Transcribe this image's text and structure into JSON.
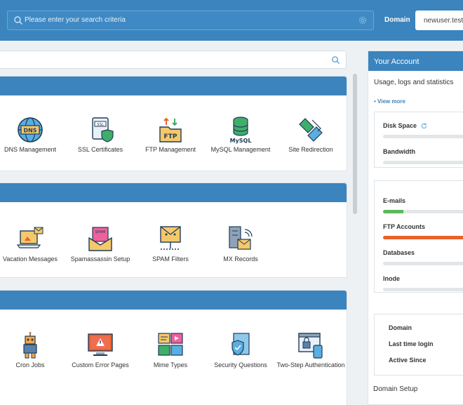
{
  "header": {
    "search_placeholder": "Please enter your search criteria",
    "domain_label": "Domain",
    "domain_value": "newuser.test"
  },
  "sections": [
    {
      "tiles": [
        {
          "label": "DNS Management",
          "icon": "dns-globe-icon"
        },
        {
          "label": "SSL Certificates",
          "icon": "ssl-certificate-icon"
        },
        {
          "label": "FTP Management",
          "icon": "ftp-folder-icon"
        },
        {
          "label": "MySQL Management",
          "icon": "mysql-database-icon"
        },
        {
          "label": "Site Redirection",
          "icon": "redirect-arrows-icon"
        }
      ]
    },
    {
      "tiles": [
        {
          "label": "Vacation Messages",
          "icon": "vacation-laptop-icon"
        },
        {
          "label": "Spamassassin Setup",
          "icon": "spam-envelope-icon"
        },
        {
          "label": "SPAM Filters",
          "icon": "spam-filter-icon"
        },
        {
          "label": "MX Records",
          "icon": "mx-server-icon"
        }
      ]
    },
    {
      "tiles": [
        {
          "label": "Cron Jobs",
          "icon": "robot-icon"
        },
        {
          "label": "Custom Error Pages",
          "icon": "error-monitor-icon"
        },
        {
          "label": "Mime Types",
          "icon": "media-types-icon"
        },
        {
          "label": "Security Questions",
          "icon": "shield-document-icon"
        },
        {
          "label": "Two-Step Authentication",
          "icon": "lock-browser-icon"
        }
      ]
    }
  ],
  "account": {
    "title": "Your Account",
    "subtitle": "Usage, logs and statistics",
    "view_more": "• View more",
    "usage": [
      {
        "label": "Disk Space",
        "fraction": 0
      },
      {
        "label": "Bandwidth",
        "fraction": 0
      }
    ],
    "limits": [
      {
        "label": "E-mails",
        "fraction": 0.22,
        "color": "#5cb85c"
      },
      {
        "label": "FTP Accounts",
        "fraction": 1.0,
        "color": "#e8632b"
      },
      {
        "label": "Databases",
        "fraction": 0
      },
      {
        "label": "Inode",
        "fraction": 0
      }
    ],
    "info": [
      "Domain",
      "Last time login",
      "Active Since"
    ],
    "domain_setup": "Domain Setup"
  },
  "colors": {
    "brand": "#3b84bd",
    "ok": "#5cb85c",
    "warn": "#e8632b"
  }
}
